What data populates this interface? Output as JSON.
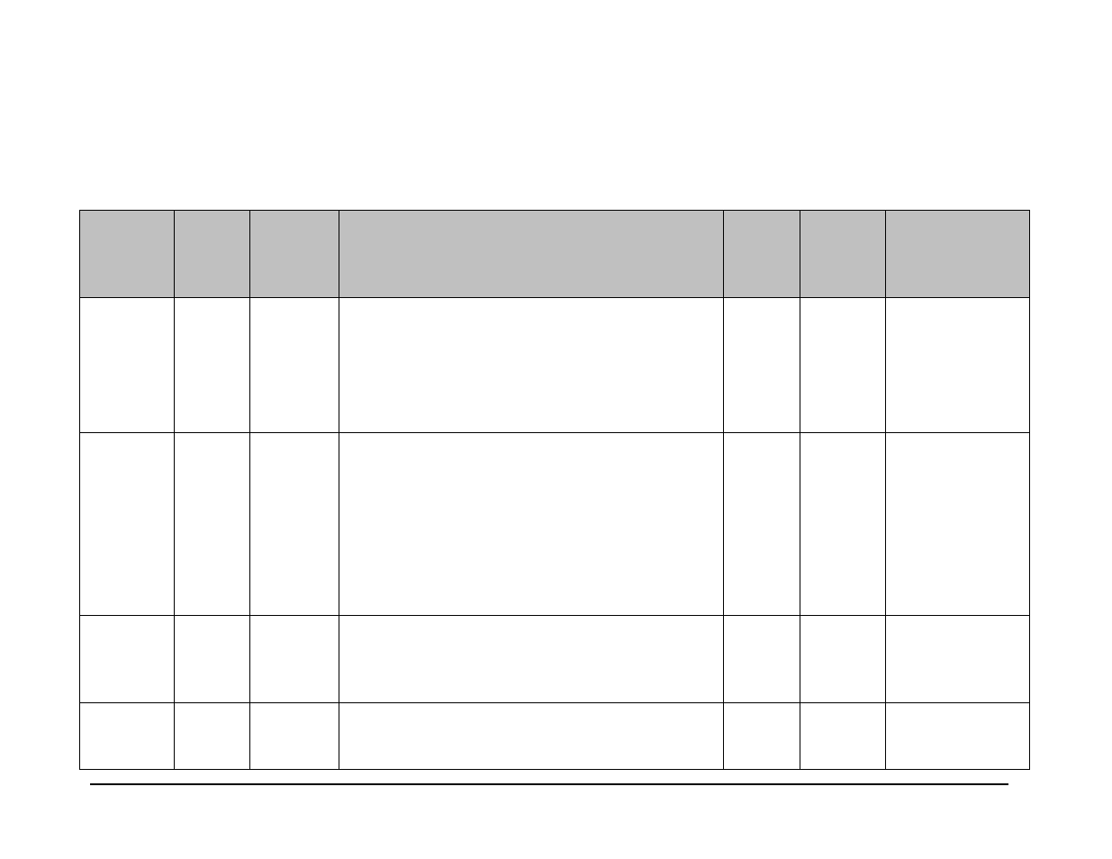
{
  "table": {
    "headers": [
      "",
      "",
      "",
      "",
      "",
      "",
      ""
    ],
    "rows": [
      [
        "",
        "",
        "",
        "",
        "",
        "",
        ""
      ],
      [
        "",
        "",
        "",
        "",
        "",
        "",
        ""
      ],
      [
        "",
        "",
        "",
        "",
        "",
        "",
        ""
      ],
      [
        "",
        "",
        "",
        "",
        "",
        "",
        ""
      ]
    ]
  }
}
